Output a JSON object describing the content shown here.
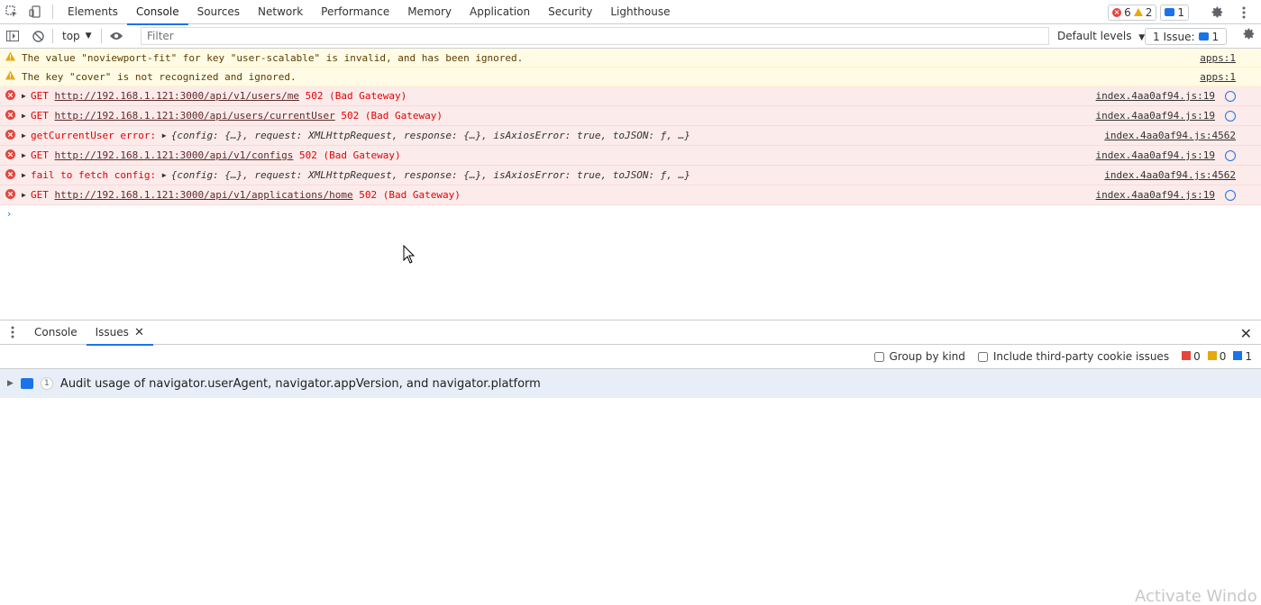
{
  "tabbar": {
    "tabs": [
      "Elements",
      "Console",
      "Sources",
      "Network",
      "Performance",
      "Memory",
      "Application",
      "Security",
      "Lighthouse"
    ],
    "active_tab": "Console",
    "error_count": "6",
    "warning_count": "2",
    "message_count": "1"
  },
  "console_toolbar": {
    "context": "top",
    "filter_placeholder": "Filter",
    "levels_label": "Default levels",
    "issues_label": "1 Issue:",
    "issues_count": "1"
  },
  "messages": [
    {
      "level": "warning",
      "text": "The value \"noviewport-fit\" for key \"user-scalable\" is invalid, and has been ignored.",
      "source": "apps:1"
    },
    {
      "level": "warning",
      "text": "The key \"cover\" is not recognized and ignored.",
      "source": "apps:1"
    },
    {
      "level": "error",
      "method": "GET",
      "url": "http://192.168.1.121:3000/api/v1/users/me",
      "status": "502 (Bad Gateway)",
      "source": "index.4aa0af94.js:19"
    },
    {
      "level": "error",
      "method": "GET",
      "url": "http://192.168.1.121:3000/api/users/currentUser",
      "status": "502 (Bad Gateway)",
      "source": "index.4aa0af94.js:19"
    },
    {
      "level": "error",
      "label": "getCurrentUser error:",
      "obj": "{config: {…}, request: XMLHttpRequest, response: {…}, isAxiosError: true, toJSON: ƒ, …}",
      "source": "index.4aa0af94.js:4562"
    },
    {
      "level": "error",
      "method": "GET",
      "url": "http://192.168.1.121:3000/api/v1/configs",
      "status": "502 (Bad Gateway)",
      "source": "index.4aa0af94.js:19"
    },
    {
      "level": "error",
      "label": "fail to fetch config:",
      "obj": "{config: {…}, request: XMLHttpRequest, response: {…}, isAxiosError: true, toJSON: ƒ, …}",
      "source": "index.4aa0af94.js:4562"
    },
    {
      "level": "error",
      "method": "GET",
      "url": "http://192.168.1.121:3000/api/v1/applications/home",
      "status": "502 (Bad Gateway)",
      "source": "index.4aa0af94.js:19"
    }
  ],
  "drawer": {
    "tabs": [
      "Console",
      "Issues"
    ],
    "active_tab": "Issues",
    "group_by_kind": "Group by kind",
    "third_party": "Include third-party cookie issues",
    "err_count": "0",
    "warn_count": "0",
    "info_count": "1",
    "issue": {
      "count": "1",
      "title": "Audit usage of navigator.userAgent, navigator.appVersion, and navigator.platform"
    }
  },
  "watermark": "Activate Windo",
  "colors": {
    "accent": "#1a73e8",
    "error_bg": "#fcebeb",
    "warning_bg": "#fffbe5",
    "error_text": "#e50000"
  }
}
